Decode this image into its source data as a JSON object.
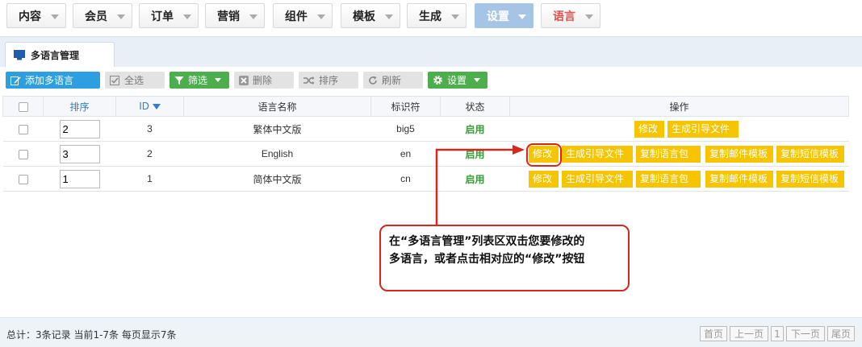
{
  "nav": {
    "items": [
      {
        "label": "内容"
      },
      {
        "label": "会员"
      },
      {
        "label": "订单"
      },
      {
        "label": "营销"
      },
      {
        "label": "组件"
      },
      {
        "label": "模板"
      },
      {
        "label": "生成"
      },
      {
        "label": "设置"
      },
      {
        "label": "语言"
      }
    ],
    "active_index": 7
  },
  "panel": {
    "tab_label": "多语言管理"
  },
  "toolbar": {
    "add": "添加多语言",
    "select_all": "全选",
    "filter": "筛选",
    "delete": "删除",
    "sort": "排序",
    "refresh": "刷新",
    "settings": "设置"
  },
  "table": {
    "headers": {
      "order": "排序",
      "id": "ID",
      "name": "语言名称",
      "code": "标识符",
      "status": "状态",
      "ops": "操作"
    },
    "rows": [
      {
        "order": "2",
        "id": "3",
        "name": "繁体中文版",
        "code": "big5",
        "status": "启用",
        "ops": [
          "修改",
          "生成引导文件"
        ]
      },
      {
        "order": "3",
        "id": "2",
        "name": "English",
        "code": "en",
        "status": "启用",
        "ops": [
          "修改",
          "生成引导文件",
          "复制语言包",
          "复制邮件模板",
          "复制短信模板"
        ]
      },
      {
        "order": "1",
        "id": "1",
        "name": "简体中文版",
        "code": "cn",
        "status": "启用",
        "ops": [
          "修改",
          "生成引导文件",
          "复制语言包",
          "复制邮件模板",
          "复制短信模板"
        ]
      }
    ]
  },
  "annotation": {
    "line1": "在“多语言管理”列表区双击您要修改的",
    "line2": "多语言，或者点击相对应的“修改”按钮"
  },
  "footer": {
    "summary": "总计：3条记录 当前1-7条 每页显示7条",
    "first": "首页",
    "prev": "上一页",
    "page": "1",
    "next": "下一页",
    "last": "尾页"
  },
  "colors": {
    "accent": "#2d9ee0",
    "op_button": "#f7c400",
    "annotation": "#d9261c",
    "active_nav": "#a6c4e6"
  }
}
